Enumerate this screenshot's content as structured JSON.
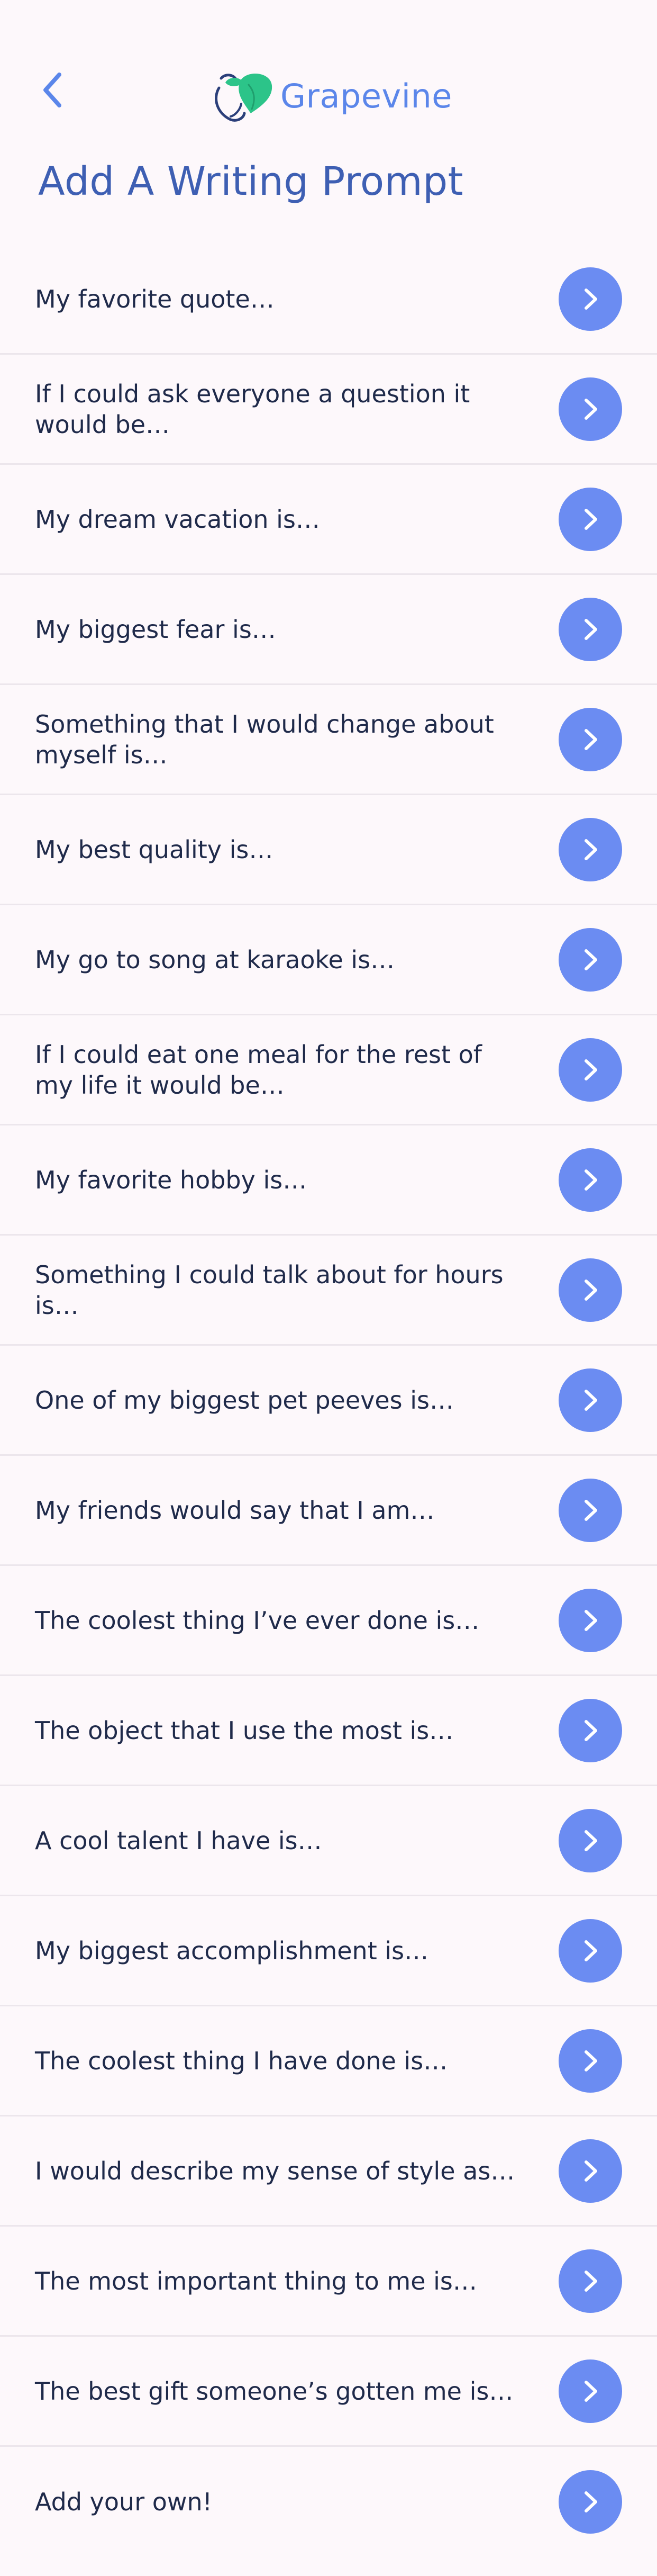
{
  "header": {
    "brand_name": "Grapevine",
    "title": "Add A Writing Prompt"
  },
  "icons": {
    "back": "chevron-left-icon",
    "logo": "grapevine-leaf-logo",
    "item_action": "chevron-right-icon"
  },
  "colors": {
    "background": "#fdf8fb",
    "accent": "#6b8cf2",
    "title": "#3e5fb3",
    "logo_green": "#2cc489",
    "text": "#1f2a4a"
  },
  "prompts": [
    "My favorite quote…",
    "If I could ask everyone a question it would be…",
    "My dream vacation is…",
    "My biggest fear is…",
    "Something that I would change about myself is…",
    "My best quality is…",
    "My go to song at karaoke is…",
    "If I could eat one meal for the rest of my life it would be…",
    "My favorite hobby is…",
    "Something I could talk about for hours is…",
    "One of my biggest pet peeves is…",
    "My friends would say that I am…",
    "The coolest thing I’ve ever done is…",
    "The object that I use the most is…",
    "A cool talent I have is…",
    "My biggest accomplishment is…",
    "The coolest thing I have done is…",
    "I would describe my sense of style as…",
    "The most important thing to me is…",
    "The best gift someone’s gotten me is…",
    "Add your own!"
  ]
}
